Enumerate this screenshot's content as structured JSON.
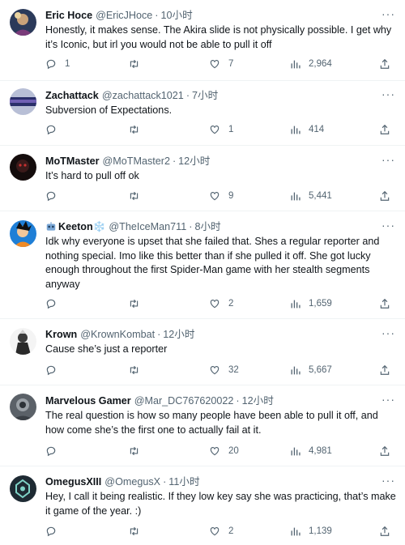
{
  "colors": {
    "text": "#0f1419",
    "muted": "#536471",
    "divider": "#eff3f4",
    "verified_blue": "#1d9bf0"
  },
  "icons": {
    "reply": "reply-icon",
    "retweet": "retweet-icon",
    "like": "heart-icon",
    "views": "views-bar-chart-icon",
    "share": "share-icon",
    "more": "more-dots-icon"
  },
  "more_label": "···",
  "tweets": [
    {
      "name": "Eric Hoce",
      "handle": "@EricJHoce",
      "sep": "·",
      "time": "10小时",
      "text": "Honestly, it makes sense. The Akira slide is not physically possible. I get why it’s Iconic, but irl you would not be able to pull it off",
      "replies": "1",
      "retweets": "",
      "likes": "7",
      "views": "2,964",
      "avatar": "avatar-eric"
    },
    {
      "name": "Zachattack",
      "handle": "@zachattack1021",
      "sep": "·",
      "time": "7小时",
      "text": "Subversion of Expectations.",
      "replies": "",
      "retweets": "",
      "likes": "1",
      "views": "414",
      "avatar": "avatar-zach"
    },
    {
      "name": "MoTMaster",
      "handle": "@MoTMaster2",
      "sep": "·",
      "time": "12小时",
      "text": "It’s hard to pull off ok",
      "replies": "",
      "retweets": "",
      "likes": "9",
      "views": "5,441",
      "avatar": "avatar-mot"
    },
    {
      "name": "Keeton",
      "name_suffix": "❄️",
      "handle": "@TheIceMan711",
      "sep": "·",
      "time": "8小时",
      "text": "Idk why everyone is upset that she failed that. Shes a regular reporter and nothing special. Imo like this better than if she pulled it off. She got lucky enough throughout the first Spider-Man game with her stealth segments anyway",
      "replies": "",
      "retweets": "",
      "likes": "2",
      "views": "1,659",
      "avatar": "avatar-keeton"
    },
    {
      "name": "Krown",
      "handle": "@KrownKombat",
      "sep": "·",
      "time": "12小时",
      "text": "Cause she’s just a reporter",
      "replies": "",
      "retweets": "",
      "likes": "32",
      "views": "5,667",
      "avatar": "avatar-krown"
    },
    {
      "name": "Marvelous Gamer",
      "handle": "@Mar_DC767620022",
      "sep": "·",
      "time": "12小时",
      "text": "The real question is how so many people have been able to pull it off, and how come she’s the first one to actually fail at it.",
      "replies": "",
      "retweets": "",
      "likes": "20",
      "views": "4,981",
      "avatar": "avatar-marvelous"
    },
    {
      "name": "OmegusXIII",
      "handle": "@OmegusX",
      "sep": "·",
      "time": "11小时",
      "text": "Hey, I call it being realistic. If they low key say she was practicing, that’s make it game of the year. :)",
      "replies": "",
      "retweets": "",
      "likes": "2",
      "views": "1,139",
      "avatar": "avatar-omegus"
    }
  ]
}
